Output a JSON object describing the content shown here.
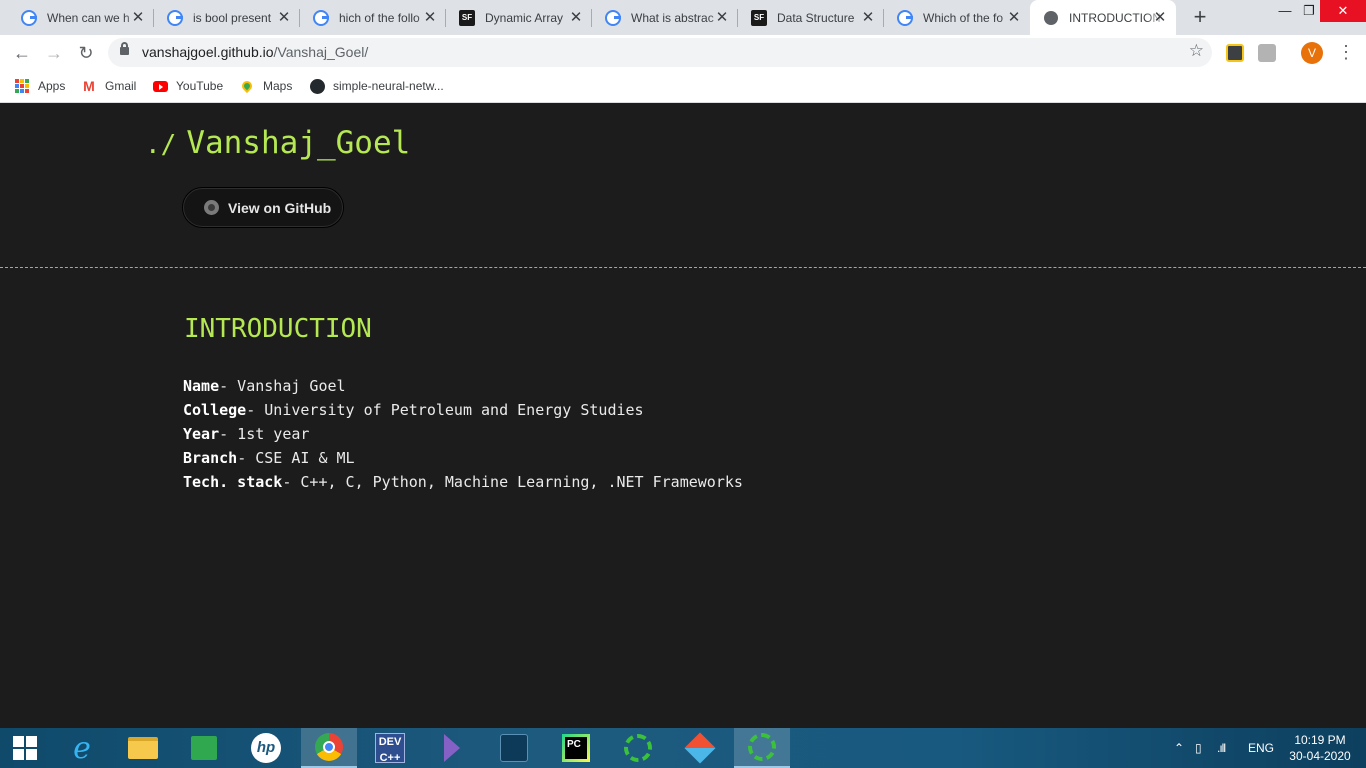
{
  "browser": {
    "tabs": [
      {
        "title": "When can we h",
        "favicon": "google-icon",
        "active": false
      },
      {
        "title": "is bool present",
        "favicon": "google-icon",
        "active": false
      },
      {
        "title": "hich of the follo",
        "favicon": "google-icon",
        "active": false
      },
      {
        "title": "Dynamic Array",
        "favicon": "sanfoundry-icon",
        "active": false
      },
      {
        "title": "What is abstrac",
        "favicon": "google-icon",
        "active": false
      },
      {
        "title": "Data Structure",
        "favicon": "sanfoundry-icon",
        "active": false
      },
      {
        "title": "Which of the fo",
        "favicon": "google-icon",
        "active": false
      },
      {
        "title": "INTRODUCTION",
        "favicon": "globe-icon",
        "active": true
      }
    ],
    "url_host": "vanshajgoel.github.io",
    "url_path": "/Vanshaj_Goel/",
    "profile_initial": "V",
    "bookmarks": [
      {
        "label": "Apps",
        "icon": "apps-grid-icon"
      },
      {
        "label": "Gmail",
        "icon": "gmail-icon"
      },
      {
        "label": "YouTube",
        "icon": "youtube-icon"
      },
      {
        "label": "Maps",
        "icon": "maps-pin-icon"
      },
      {
        "label": "simple-neural-netw...",
        "icon": "github-icon"
      }
    ]
  },
  "page": {
    "site_prefix": "./",
    "site_title": "Vanshaj_Goel",
    "github_button": "View on GitHub",
    "section_heading": "INTRODUCTION",
    "info": [
      {
        "key": "Name",
        "value": "- Vanshaj Goel"
      },
      {
        "key": "College",
        "value": "- University of Petroleum and Energy Studies"
      },
      {
        "key": "Year",
        "value": "- 1st year"
      },
      {
        "key": "Branch",
        "value": "- CSE AI & ML"
      },
      {
        "key": "Tech. stack",
        "value": "- C++, C, Python, Machine Learning, .NET Frameworks"
      }
    ],
    "colors": {
      "accent": "#b5e853",
      "background": "#1c1c1c",
      "text": "#eaeaea"
    }
  },
  "taskbar": {
    "apps": [
      "windows-start-icon",
      "internet-explorer-icon",
      "file-explorer-icon",
      "store-icon",
      "hp-icon",
      "chrome-icon",
      "devcpp-icon",
      "visual-studio-icon",
      "mysql-workbench-icon",
      "pycharm-icon",
      "circle-app-icon",
      "git-icon",
      "circle-app-icon"
    ],
    "language": "ENG",
    "time": "10:19 PM",
    "date": "30-04-2020"
  }
}
